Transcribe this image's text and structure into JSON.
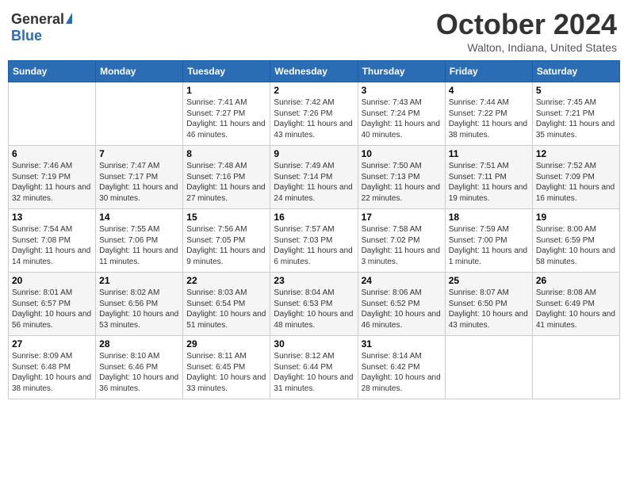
{
  "header": {
    "logo_general": "General",
    "logo_blue": "Blue",
    "title": "October 2024",
    "location": "Walton, Indiana, United States"
  },
  "days_of_week": [
    "Sunday",
    "Monday",
    "Tuesday",
    "Wednesday",
    "Thursday",
    "Friday",
    "Saturday"
  ],
  "weeks": [
    [
      {
        "day": null,
        "info": null
      },
      {
        "day": null,
        "info": null
      },
      {
        "day": "1",
        "sunrise": "Sunrise: 7:41 AM",
        "sunset": "Sunset: 7:27 PM",
        "daylight": "Daylight: 11 hours and 46 minutes."
      },
      {
        "day": "2",
        "sunrise": "Sunrise: 7:42 AM",
        "sunset": "Sunset: 7:26 PM",
        "daylight": "Daylight: 11 hours and 43 minutes."
      },
      {
        "day": "3",
        "sunrise": "Sunrise: 7:43 AM",
        "sunset": "Sunset: 7:24 PM",
        "daylight": "Daylight: 11 hours and 40 minutes."
      },
      {
        "day": "4",
        "sunrise": "Sunrise: 7:44 AM",
        "sunset": "Sunset: 7:22 PM",
        "daylight": "Daylight: 11 hours and 38 minutes."
      },
      {
        "day": "5",
        "sunrise": "Sunrise: 7:45 AM",
        "sunset": "Sunset: 7:21 PM",
        "daylight": "Daylight: 11 hours and 35 minutes."
      }
    ],
    [
      {
        "day": "6",
        "sunrise": "Sunrise: 7:46 AM",
        "sunset": "Sunset: 7:19 PM",
        "daylight": "Daylight: 11 hours and 32 minutes."
      },
      {
        "day": "7",
        "sunrise": "Sunrise: 7:47 AM",
        "sunset": "Sunset: 7:17 PM",
        "daylight": "Daylight: 11 hours and 30 minutes."
      },
      {
        "day": "8",
        "sunrise": "Sunrise: 7:48 AM",
        "sunset": "Sunset: 7:16 PM",
        "daylight": "Daylight: 11 hours and 27 minutes."
      },
      {
        "day": "9",
        "sunrise": "Sunrise: 7:49 AM",
        "sunset": "Sunset: 7:14 PM",
        "daylight": "Daylight: 11 hours and 24 minutes."
      },
      {
        "day": "10",
        "sunrise": "Sunrise: 7:50 AM",
        "sunset": "Sunset: 7:13 PM",
        "daylight": "Daylight: 11 hours and 22 minutes."
      },
      {
        "day": "11",
        "sunrise": "Sunrise: 7:51 AM",
        "sunset": "Sunset: 7:11 PM",
        "daylight": "Daylight: 11 hours and 19 minutes."
      },
      {
        "day": "12",
        "sunrise": "Sunrise: 7:52 AM",
        "sunset": "Sunset: 7:09 PM",
        "daylight": "Daylight: 11 hours and 16 minutes."
      }
    ],
    [
      {
        "day": "13",
        "sunrise": "Sunrise: 7:54 AM",
        "sunset": "Sunset: 7:08 PM",
        "daylight": "Daylight: 11 hours and 14 minutes."
      },
      {
        "day": "14",
        "sunrise": "Sunrise: 7:55 AM",
        "sunset": "Sunset: 7:06 PM",
        "daylight": "Daylight: 11 hours and 11 minutes."
      },
      {
        "day": "15",
        "sunrise": "Sunrise: 7:56 AM",
        "sunset": "Sunset: 7:05 PM",
        "daylight": "Daylight: 11 hours and 9 minutes."
      },
      {
        "day": "16",
        "sunrise": "Sunrise: 7:57 AM",
        "sunset": "Sunset: 7:03 PM",
        "daylight": "Daylight: 11 hours and 6 minutes."
      },
      {
        "day": "17",
        "sunrise": "Sunrise: 7:58 AM",
        "sunset": "Sunset: 7:02 PM",
        "daylight": "Daylight: 11 hours and 3 minutes."
      },
      {
        "day": "18",
        "sunrise": "Sunrise: 7:59 AM",
        "sunset": "Sunset: 7:00 PM",
        "daylight": "Daylight: 11 hours and 1 minute."
      },
      {
        "day": "19",
        "sunrise": "Sunrise: 8:00 AM",
        "sunset": "Sunset: 6:59 PM",
        "daylight": "Daylight: 10 hours and 58 minutes."
      }
    ],
    [
      {
        "day": "20",
        "sunrise": "Sunrise: 8:01 AM",
        "sunset": "Sunset: 6:57 PM",
        "daylight": "Daylight: 10 hours and 56 minutes."
      },
      {
        "day": "21",
        "sunrise": "Sunrise: 8:02 AM",
        "sunset": "Sunset: 6:56 PM",
        "daylight": "Daylight: 10 hours and 53 minutes."
      },
      {
        "day": "22",
        "sunrise": "Sunrise: 8:03 AM",
        "sunset": "Sunset: 6:54 PM",
        "daylight": "Daylight: 10 hours and 51 minutes."
      },
      {
        "day": "23",
        "sunrise": "Sunrise: 8:04 AM",
        "sunset": "Sunset: 6:53 PM",
        "daylight": "Daylight: 10 hours and 48 minutes."
      },
      {
        "day": "24",
        "sunrise": "Sunrise: 8:06 AM",
        "sunset": "Sunset: 6:52 PM",
        "daylight": "Daylight: 10 hours and 46 minutes."
      },
      {
        "day": "25",
        "sunrise": "Sunrise: 8:07 AM",
        "sunset": "Sunset: 6:50 PM",
        "daylight": "Daylight: 10 hours and 43 minutes."
      },
      {
        "day": "26",
        "sunrise": "Sunrise: 8:08 AM",
        "sunset": "Sunset: 6:49 PM",
        "daylight": "Daylight: 10 hours and 41 minutes."
      }
    ],
    [
      {
        "day": "27",
        "sunrise": "Sunrise: 8:09 AM",
        "sunset": "Sunset: 6:48 PM",
        "daylight": "Daylight: 10 hours and 38 minutes."
      },
      {
        "day": "28",
        "sunrise": "Sunrise: 8:10 AM",
        "sunset": "Sunset: 6:46 PM",
        "daylight": "Daylight: 10 hours and 36 minutes."
      },
      {
        "day": "29",
        "sunrise": "Sunrise: 8:11 AM",
        "sunset": "Sunset: 6:45 PM",
        "daylight": "Daylight: 10 hours and 33 minutes."
      },
      {
        "day": "30",
        "sunrise": "Sunrise: 8:12 AM",
        "sunset": "Sunset: 6:44 PM",
        "daylight": "Daylight: 10 hours and 31 minutes."
      },
      {
        "day": "31",
        "sunrise": "Sunrise: 8:14 AM",
        "sunset": "Sunset: 6:42 PM",
        "daylight": "Daylight: 10 hours and 28 minutes."
      },
      {
        "day": null,
        "info": null
      },
      {
        "day": null,
        "info": null
      }
    ]
  ]
}
